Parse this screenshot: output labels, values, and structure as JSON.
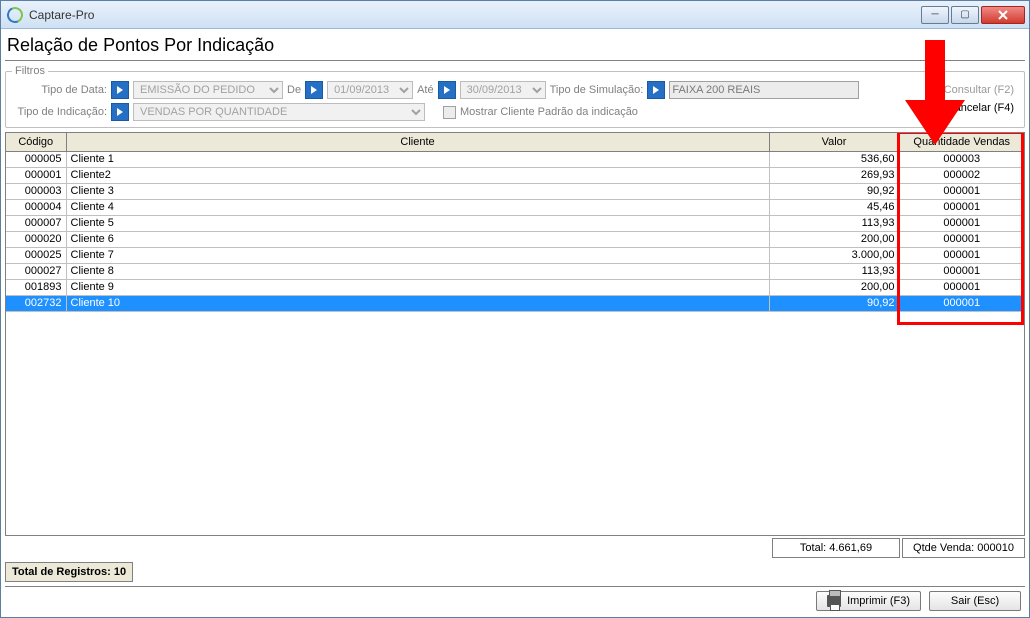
{
  "window": {
    "title": "Captare-Pro"
  },
  "page_title": "Relação de Pontos Por Indicação",
  "filters": {
    "legend": "Filtros",
    "tipo_data_label": "Tipo de Data:",
    "tipo_data_value": "EMISSÃO DO PEDIDO",
    "de_label": "De",
    "de_value": "01/09/2013",
    "ate_label": "Até",
    "ate_value": "30/09/2013",
    "tipo_simulacao_label": "Tipo de Simulação:",
    "tipo_simulacao_value": "FAIXA 200 REAIS",
    "tipo_indicacao_label": "Tipo de Indicação:",
    "tipo_indicacao_value": "VENDAS POR QUANTIDADE",
    "mostrar_cliente_label": "Mostrar Cliente Padrão da indicação",
    "consultar_label": "Consultar (F2)",
    "cancelar_label": "Cancelar (F4)"
  },
  "columns": {
    "codigo": "Código",
    "cliente": "Cliente",
    "valor": "Valor",
    "qtd": "Quantidade Vendas"
  },
  "rows": [
    {
      "codigo": "000005",
      "cliente": "Cliente 1",
      "valor": "536,60",
      "qtd": "000003"
    },
    {
      "codigo": "000001",
      "cliente": "Cliente2",
      "valor": "269,93",
      "qtd": "000002"
    },
    {
      "codigo": "000003",
      "cliente": "Cliente 3",
      "valor": "90,92",
      "qtd": "000001"
    },
    {
      "codigo": "000004",
      "cliente": "Cliente 4",
      "valor": "45,46",
      "qtd": "000001"
    },
    {
      "codigo": "000007",
      "cliente": "Cliente 5",
      "valor": "113,93",
      "qtd": "000001"
    },
    {
      "codigo": "000020",
      "cliente": "Cliente 6",
      "valor": "200,00",
      "qtd": "000001"
    },
    {
      "codigo": "000025",
      "cliente": "Cliente 7",
      "valor": "3.000,00",
      "qtd": "000001"
    },
    {
      "codigo": "000027",
      "cliente": "Cliente 8",
      "valor": "113,93",
      "qtd": "000001"
    },
    {
      "codigo": "001893",
      "cliente": "Cliente 9",
      "valor": "200,00",
      "qtd": "000001"
    },
    {
      "codigo": "002732",
      "cliente": "Cliente 10",
      "valor": "90,92",
      "qtd": "000001"
    }
  ],
  "selected_row_index": 9,
  "totals": {
    "valor": "Total: 4.661,69",
    "qtd": "Qtde Venda: 000010"
  },
  "reg_count": "Total de Registros: 10",
  "buttons": {
    "imprimir": "Imprimir (F3)",
    "sair": "Sair (Esc)"
  }
}
